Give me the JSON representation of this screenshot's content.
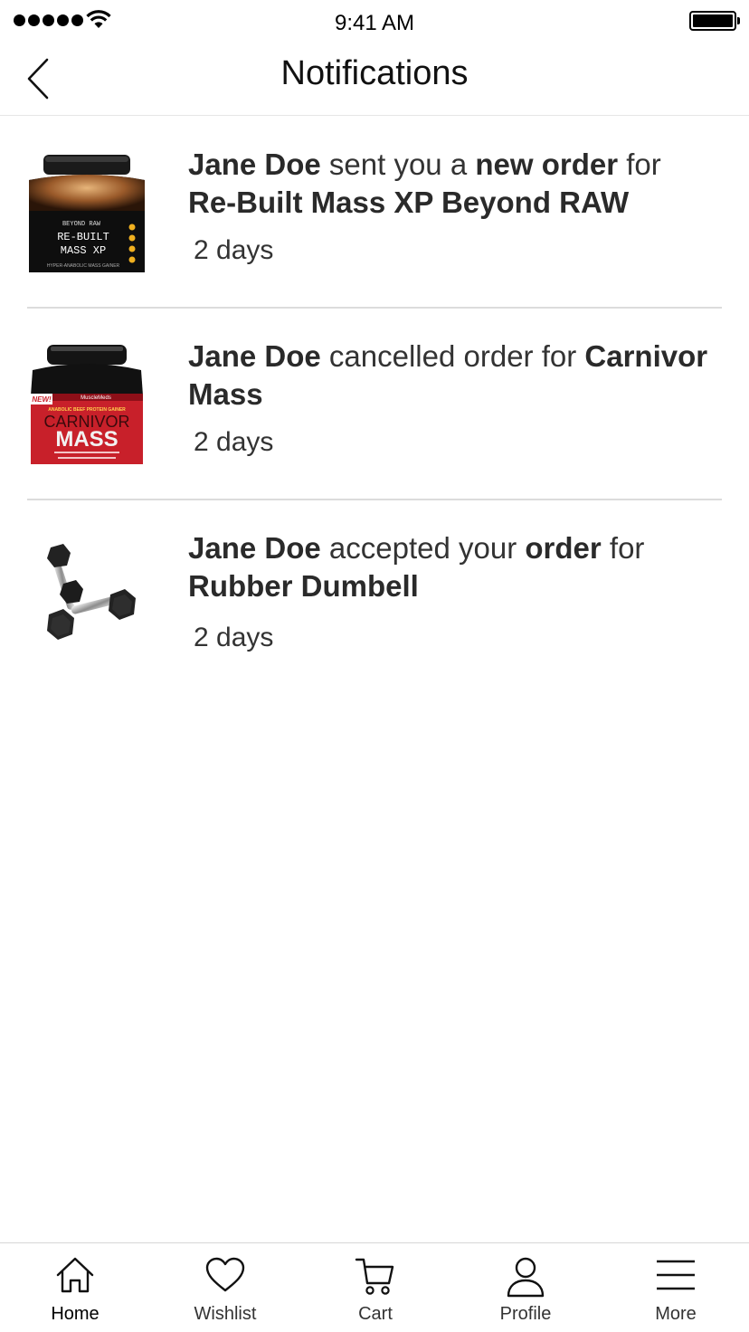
{
  "status_bar": {
    "time": "9:41 AM"
  },
  "header": {
    "title": "Notifications"
  },
  "notifications": [
    {
      "product_icon": "rebuilt-mass-tub",
      "actor": "Jane Doe",
      "text1": " sent you a ",
      "bold1": "new order",
      "text2": " for ",
      "product": "Re-Built Mass XP Beyond RAW",
      "time": "2 days"
    },
    {
      "product_icon": "carnivor-mass-tub",
      "actor": "Jane Doe",
      "text1": " cancelled order for ",
      "product": "Carnivor Mass",
      "time": "2 days"
    },
    {
      "product_icon": "dumbbell",
      "actor": "Jane Doe",
      "text1": " accepted your ",
      "bold1": "order",
      "text2": " for ",
      "product": "Rubber Dumbell",
      "time": "2 days"
    }
  ],
  "product_images": {
    "rebuilt": {
      "brand": "BEYOND RAW",
      "line1": "RE-BUILT",
      "line2": "MASS XP",
      "sub": "HYPER-ANABOLIC MASS GAINER"
    },
    "carnivor": {
      "badge": "NEW!",
      "brand": "MuscleMeds",
      "tagline": "ANABOLIC BEEF PROTEIN GAINER",
      "line1": "CARNIVOR",
      "line2": "MASS"
    }
  },
  "tabs": [
    {
      "label": "Home",
      "icon": "home-icon",
      "active": true
    },
    {
      "label": "Wishlist",
      "icon": "heart-icon"
    },
    {
      "label": "Cart",
      "icon": "cart-icon"
    },
    {
      "label": "Profile",
      "icon": "user-icon"
    },
    {
      "label": "More",
      "icon": "menu-icon"
    }
  ],
  "colors": {
    "divider": "#dcdcdc",
    "text": "#333333",
    "carnivor_red": "#c8202a"
  }
}
